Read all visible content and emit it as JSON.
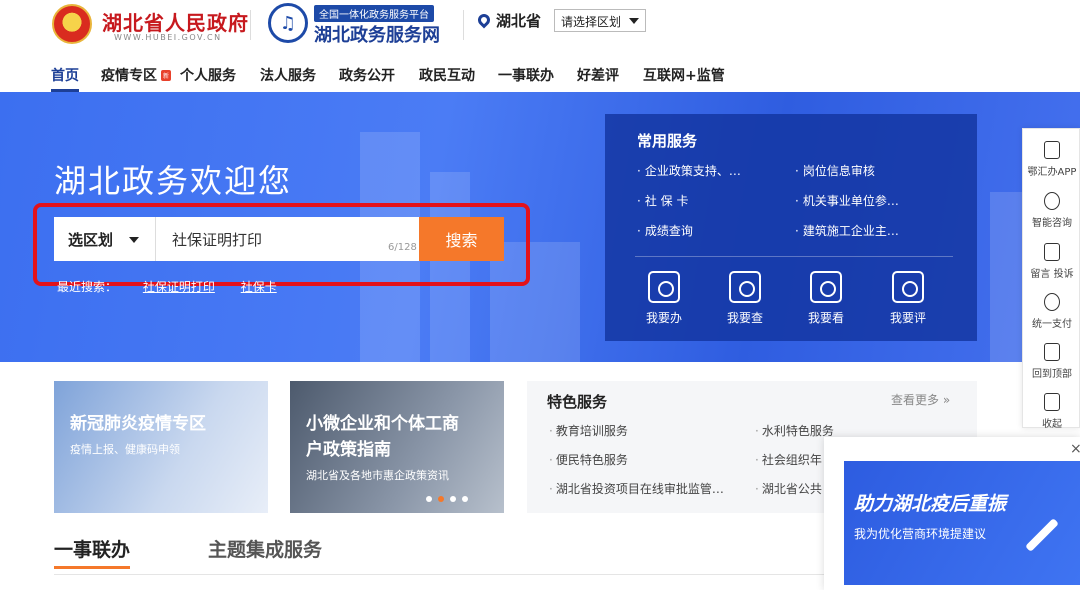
{
  "header": {
    "gov_name": "湖北省人民政府",
    "gov_url": "WWW.HUBEI.GOV.CN",
    "portal_tag": "全国一体化政务服务平台",
    "portal_name": "湖北政务服务网",
    "location": "湖北省",
    "region_select": "请选择区划"
  },
  "nav": {
    "items": [
      "首页",
      "疫情专区",
      "个人服务",
      "法人服务",
      "政务公开",
      "政民互动",
      "一事联办",
      "好差评",
      "互联网+监管"
    ],
    "badge": "新"
  },
  "hero": {
    "title": "湖北政务欢迎您",
    "search_region": "选区划",
    "search_value": "社保证明打印",
    "char_count": "6/128",
    "search_button": "搜索",
    "recent_label": "最近搜索：",
    "recent_items": [
      "社保证明打印",
      "社保卡"
    ]
  },
  "common_services": {
    "title": "常用服务",
    "links": [
      "企业政策支持、…",
      "岗位信息审核",
      "社 保 卡",
      "机关事业单位参…",
      "成绩查询",
      "建筑施工企业主…"
    ],
    "quick": [
      "我要办",
      "我要查",
      "我要看",
      "我要评"
    ]
  },
  "sidebar": {
    "items": [
      "鄂汇办APP",
      "智能咨询",
      "留言 投诉",
      "统一支付",
      "回到顶部",
      "收起"
    ]
  },
  "cards": [
    {
      "title": "新冠肺炎疫情专区",
      "sub": "疫情上报、健康码申领"
    },
    {
      "title_line1": "小微企业和个体工商",
      "title_line2": "户政策指南",
      "sub": "湖北省及各地市惠企政策资讯"
    }
  ],
  "special": {
    "title": "特色服务",
    "more": "查看更多 »",
    "links": [
      "教育培训服务",
      "水利特色服务",
      "便民特色服务",
      "社会组织年",
      "湖北省投资项目在线审批监管…",
      "湖北省公共"
    ]
  },
  "tabs": [
    "一事联办",
    "主题集成服务"
  ],
  "popup": {
    "close": "×",
    "title": "助力湖北疫后重振",
    "sub": "我为优化营商环境提建议"
  },
  "colors": {
    "primary": "#1d3f96",
    "accent": "#f5782a",
    "highlight": "#e3121b"
  }
}
